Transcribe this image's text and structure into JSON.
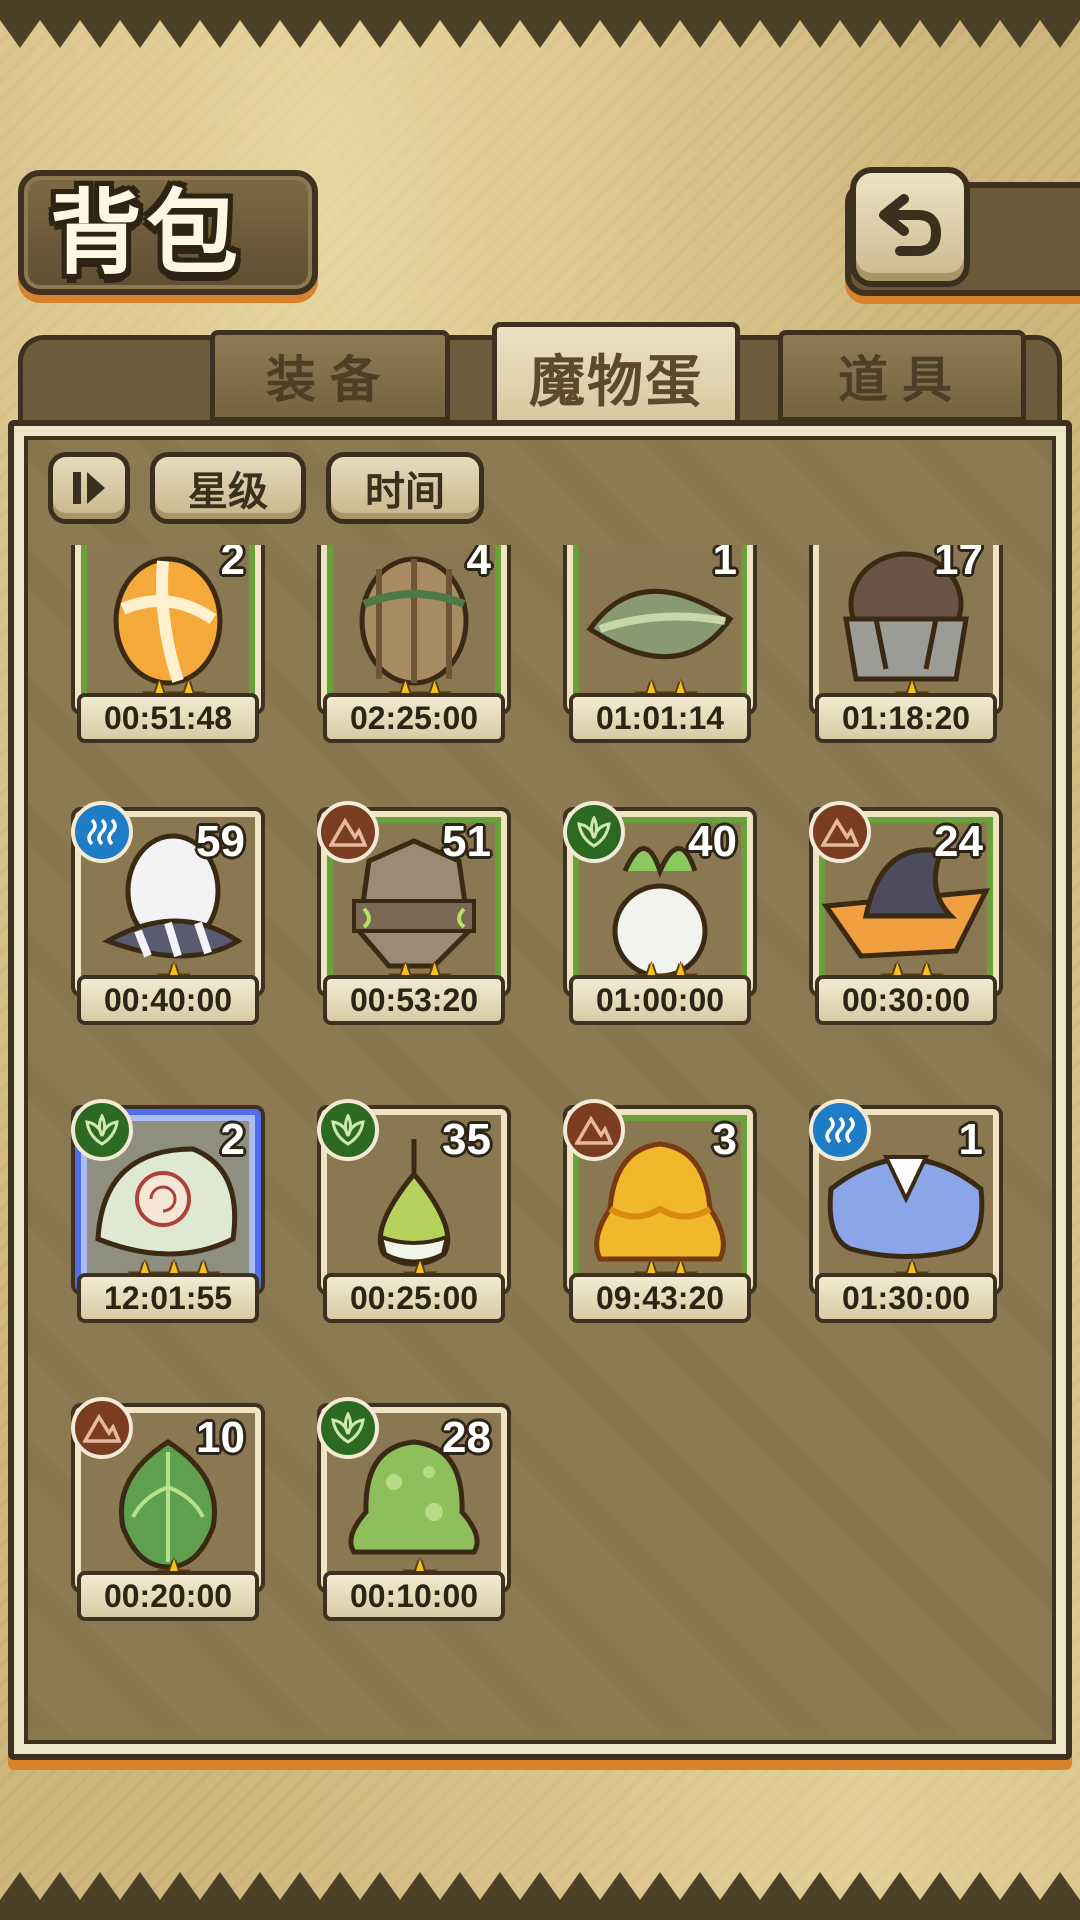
{
  "header": {
    "title": "背包",
    "back_icon": "return-arrow-icon"
  },
  "tabs": [
    {
      "label": "装备",
      "active": false
    },
    {
      "label": "魔物蛋",
      "active": true
    },
    {
      "label": "道具",
      "active": false
    }
  ],
  "sort": {
    "order_icon": "sort-order-icon",
    "star_label": "星级",
    "time_label": "时间"
  },
  "colors": {
    "star": "#f6c21e",
    "water": "#1f7dc5",
    "earth": "#7a3d22",
    "grass": "#2c6a23",
    "frame_green": "#6aa03a",
    "selected_blue": "#4f6ee8"
  },
  "eggs": [
    {
      "name": "orange-swirl-egg",
      "count": "2",
      "stars": "★★",
      "time": "00:51:48",
      "element": "",
      "frame": "green"
    },
    {
      "name": "vine-wrapped-egg",
      "count": "4",
      "stars": "★★",
      "time": "02:25:00",
      "element": "",
      "frame": "green"
    },
    {
      "name": "leaf-pod-egg",
      "count": "1",
      "stars": "★★",
      "time": "01:01:14",
      "element": "",
      "frame": "green"
    },
    {
      "name": "iron-helm-egg",
      "count": "17",
      "stars": "★",
      "time": "01:18:20",
      "element": "",
      "frame": "plain"
    },
    {
      "name": "striped-white-egg",
      "count": "59",
      "stars": "★",
      "time": "00:40:00",
      "element": "water",
      "frame": "plain"
    },
    {
      "name": "rock-golem-egg",
      "count": "51",
      "stars": "★★",
      "time": "00:53:20",
      "element": "earth",
      "frame": "green"
    },
    {
      "name": "radish-egg",
      "count": "40",
      "stars": "★★",
      "time": "01:00:00",
      "element": "grass",
      "frame": "green"
    },
    {
      "name": "witch-hat-egg",
      "count": "24",
      "stars": "★★",
      "time": "00:30:00",
      "element": "earth",
      "frame": "green"
    },
    {
      "name": "wind-leaf-egg",
      "count": "2",
      "stars": "★★★",
      "time": "12:01:55",
      "element": "grass",
      "frame": "selected"
    },
    {
      "name": "sprout-bulb-egg",
      "count": "35",
      "stars": "★",
      "time": "00:25:00",
      "element": "grass",
      "frame": "plain"
    },
    {
      "name": "golden-slime-egg",
      "count": "3",
      "stars": "★★",
      "time": "09:43:20",
      "element": "earth",
      "frame": "green"
    },
    {
      "name": "blue-feather-egg",
      "count": "1",
      "stars": "★",
      "time": "01:30:00",
      "element": "water",
      "frame": "plain"
    },
    {
      "name": "green-bud-egg",
      "count": "10",
      "stars": "★",
      "time": "00:20:00",
      "element": "earth",
      "frame": "plain"
    },
    {
      "name": "green-slime-egg",
      "count": "28",
      "stars": "★",
      "time": "00:10:00",
      "element": "grass",
      "frame": "plain"
    }
  ]
}
